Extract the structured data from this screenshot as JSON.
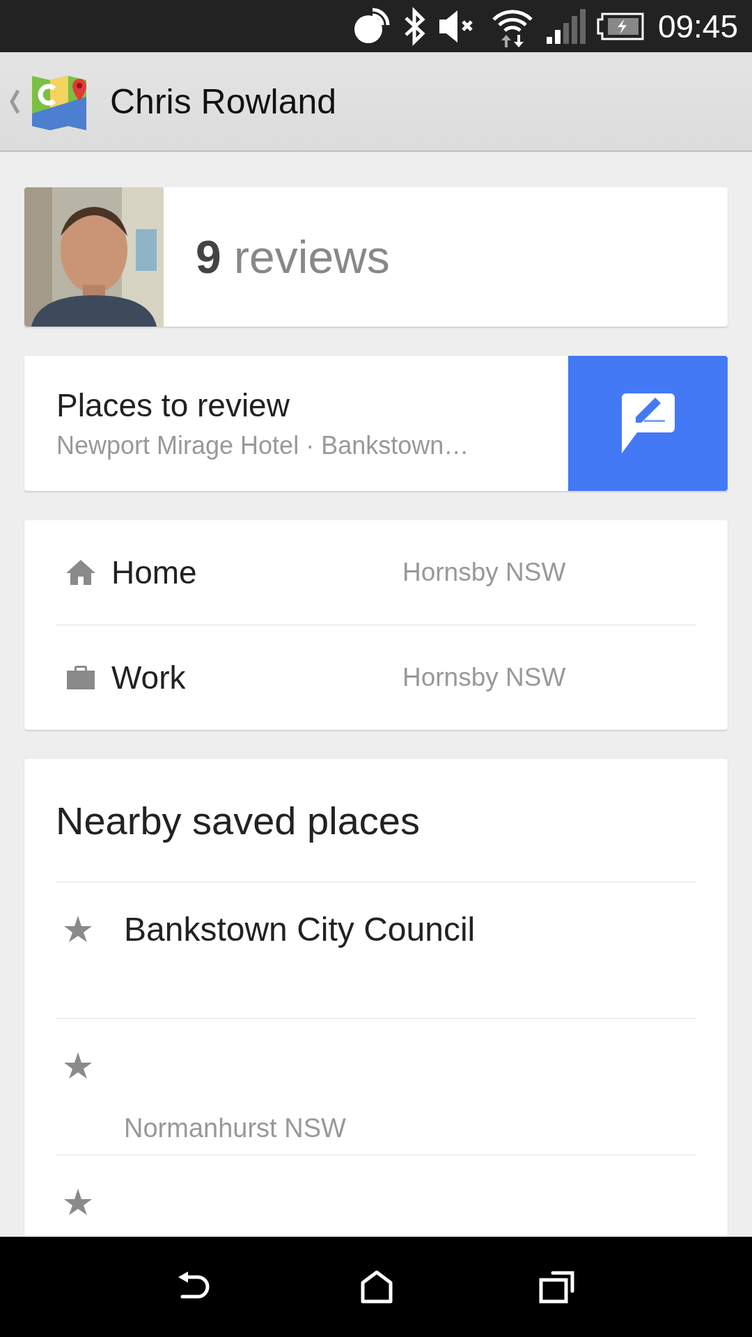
{
  "status_bar": {
    "time": "09:45"
  },
  "header": {
    "title": "Chris Rowland"
  },
  "profile": {
    "review_count": "9",
    "review_label": "reviews"
  },
  "places_to_review": {
    "title": "Places to review",
    "subtitle": "Newport Mirage Hotel · Bankstown…"
  },
  "locations": [
    {
      "kind": "home",
      "label": "Home",
      "value": "Hornsby NSW"
    },
    {
      "kind": "work",
      "label": "Work",
      "value": "Hornsby NSW"
    }
  ],
  "nearby_saved_places": {
    "title": "Nearby saved places",
    "items": [
      {
        "kind": "place",
        "title": "Bankstown City Council"
      },
      {
        "kind": "place",
        "subtitle": "Normanhurst NSW"
      },
      {
        "kind": "place"
      }
    ]
  }
}
